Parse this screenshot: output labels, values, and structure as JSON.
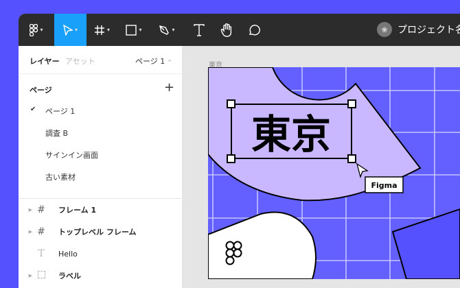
{
  "toolbar": {
    "tools": [
      "figma-menu",
      "move",
      "frame",
      "shape",
      "pen",
      "text",
      "hand",
      "comment"
    ],
    "project_name": "プロジェクト名"
  },
  "sidebar": {
    "tab_layers": "レイヤー",
    "tab_assets": "アセット",
    "current_page": "ページ 1",
    "pages_title": "ページ",
    "add": "+",
    "pages": [
      {
        "label": "ページ 1",
        "selected": true
      },
      {
        "label": "調査 B"
      },
      {
        "label": "サインイン画面"
      },
      {
        "label": "古い素材"
      }
    ],
    "layers": [
      {
        "label": "フレーム 1",
        "icon": "frame-icon"
      },
      {
        "label": "トップレベル フレーム",
        "icon": "frame-icon"
      },
      {
        "label": "Hello",
        "icon": "text-icon"
      },
      {
        "label": "ラベル",
        "icon": "group-icon"
      }
    ]
  },
  "canvas": {
    "frame_label": "東京",
    "text": "東京",
    "cursor_label": "Figma"
  },
  "colors": {
    "accent": "#18a0fb",
    "frame_bg": "#6360ff",
    "lavender": "#c8b8ff",
    "dark": "#5551ff"
  }
}
